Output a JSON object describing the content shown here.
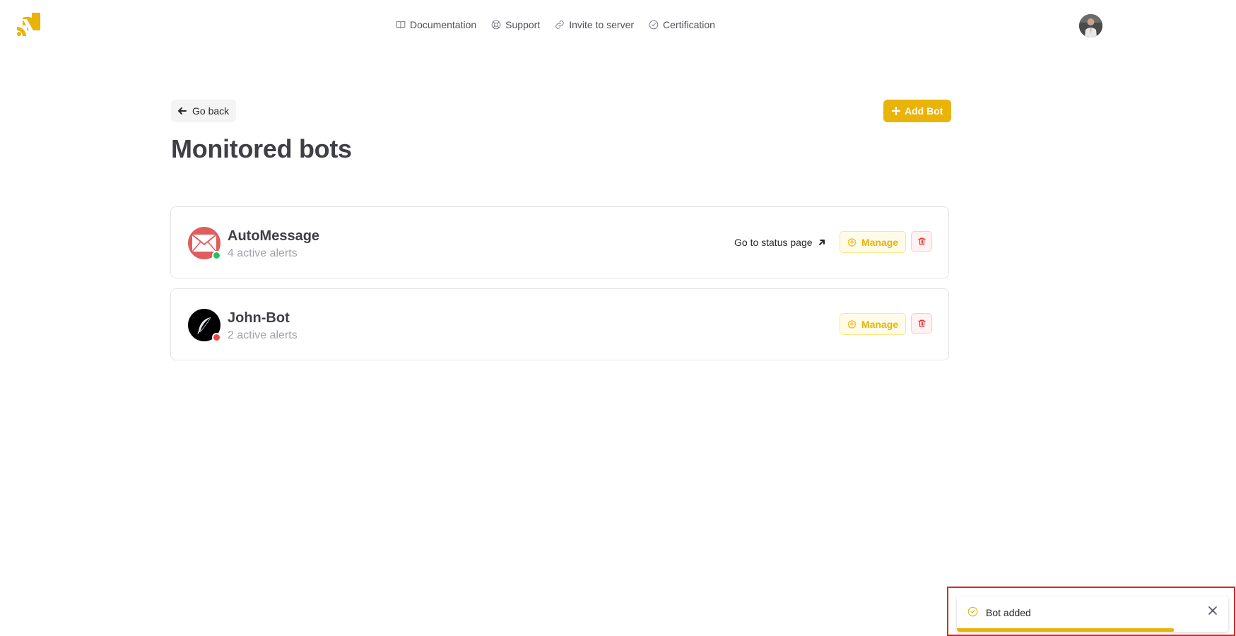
{
  "nav": {
    "items": [
      {
        "label": "Documentation",
        "icon": "book-icon"
      },
      {
        "label": "Support",
        "icon": "lifebuoy-icon"
      },
      {
        "label": "Invite to server",
        "icon": "link-icon"
      },
      {
        "label": "Certification",
        "icon": "check-circle-icon"
      }
    ]
  },
  "header": {
    "back_label": "Go back",
    "add_label": "Add Bot",
    "title": "Monitored bots"
  },
  "bots": [
    {
      "name": "AutoMessage",
      "alerts": "4 active alerts",
      "status_link": "Go to status page",
      "manage_label": "Manage",
      "status": "online",
      "status_color": "#22c55e",
      "avatar_icon": "mail-icon"
    },
    {
      "name": "John-Bot",
      "alerts": "2 active alerts",
      "manage_label": "Manage",
      "status": "offline",
      "status_color": "#ef4444",
      "avatar_icon": "feather-icon"
    }
  ],
  "toast": {
    "message": "Bot added",
    "icon": "check-circle-icon",
    "progress": 0.8
  },
  "colors": {
    "accent": "#eab308",
    "danger": "#dc2626",
    "mail_avatar": "#e05d5d"
  }
}
